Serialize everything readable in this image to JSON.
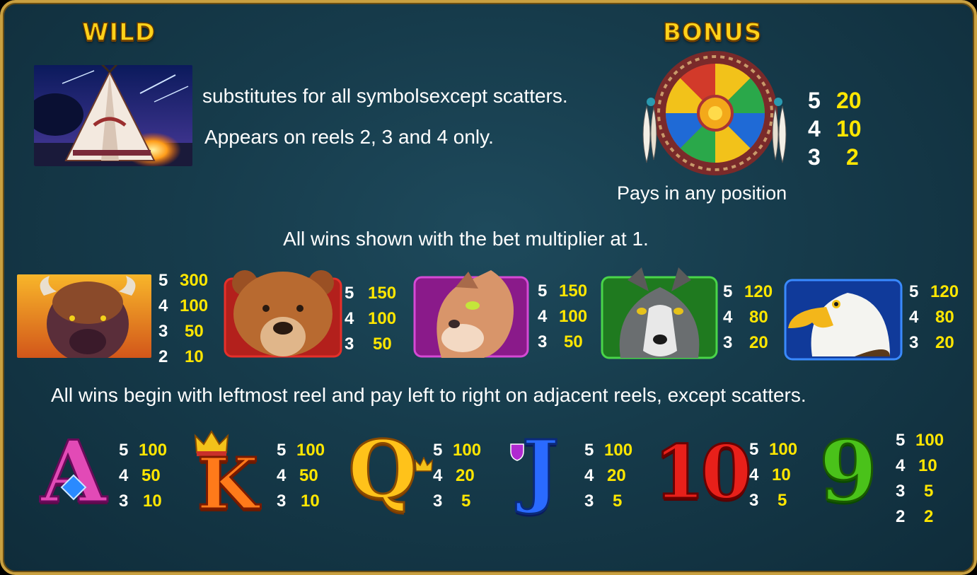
{
  "wild": {
    "title": "WILD",
    "line1": "substitutes for all symbolsexcept scatters.",
    "line2": "Appears on reels 2, 3 and 4 only."
  },
  "bonus": {
    "title": "BONUS",
    "pays": [
      {
        "count": "5",
        "value": "20"
      },
      {
        "count": "4",
        "value": "10"
      },
      {
        "count": "3",
        "value": "2"
      }
    ],
    "caption": "Pays in any position"
  },
  "notes": {
    "multiplier": "All wins shown with the bet multiplier at 1.",
    "direction": "All wins begin with leftmost reel and pay left to right on adjacent reels, except scatters."
  },
  "animals": [
    {
      "name": "buffalo",
      "pays": [
        {
          "count": "5",
          "value": "300"
        },
        {
          "count": "4",
          "value": "100"
        },
        {
          "count": "3",
          "value": "50"
        },
        {
          "count": "2",
          "value": "10"
        }
      ]
    },
    {
      "name": "bear",
      "pays": [
        {
          "count": "5",
          "value": "150"
        },
        {
          "count": "4",
          "value": "100"
        },
        {
          "count": "3",
          "value": "50"
        }
      ]
    },
    {
      "name": "cougar",
      "pays": [
        {
          "count": "5",
          "value": "150"
        },
        {
          "count": "4",
          "value": "100"
        },
        {
          "count": "3",
          "value": "50"
        }
      ]
    },
    {
      "name": "wolf",
      "pays": [
        {
          "count": "5",
          "value": "120"
        },
        {
          "count": "4",
          "value": "80"
        },
        {
          "count": "3",
          "value": "20"
        }
      ]
    },
    {
      "name": "eagle",
      "pays": [
        {
          "count": "5",
          "value": "120"
        },
        {
          "count": "4",
          "value": "80"
        },
        {
          "count": "3",
          "value": "20"
        }
      ]
    }
  ],
  "cards": [
    {
      "glyph": "A",
      "pays": [
        {
          "count": "5",
          "value": "100"
        },
        {
          "count": "4",
          "value": "50"
        },
        {
          "count": "3",
          "value": "10"
        }
      ]
    },
    {
      "glyph": "K",
      "pays": [
        {
          "count": "5",
          "value": "100"
        },
        {
          "count": "4",
          "value": "50"
        },
        {
          "count": "3",
          "value": "10"
        }
      ]
    },
    {
      "glyph": "Q",
      "pays": [
        {
          "count": "5",
          "value": "100"
        },
        {
          "count": "4",
          "value": "20"
        },
        {
          "count": "3",
          "value": "5"
        }
      ]
    },
    {
      "glyph": "J",
      "pays": [
        {
          "count": "5",
          "value": "100"
        },
        {
          "count": "4",
          "value": "20"
        },
        {
          "count": "3",
          "value": "5"
        }
      ]
    },
    {
      "glyph": "10",
      "pays": [
        {
          "count": "5",
          "value": "100"
        },
        {
          "count": "4",
          "value": "10"
        },
        {
          "count": "3",
          "value": "5"
        }
      ]
    },
    {
      "glyph": "9",
      "pays": [
        {
          "count": "5",
          "value": "100"
        },
        {
          "count": "4",
          "value": "10"
        },
        {
          "count": "3",
          "value": "5"
        },
        {
          "count": "2",
          "value": "2"
        }
      ]
    }
  ]
}
